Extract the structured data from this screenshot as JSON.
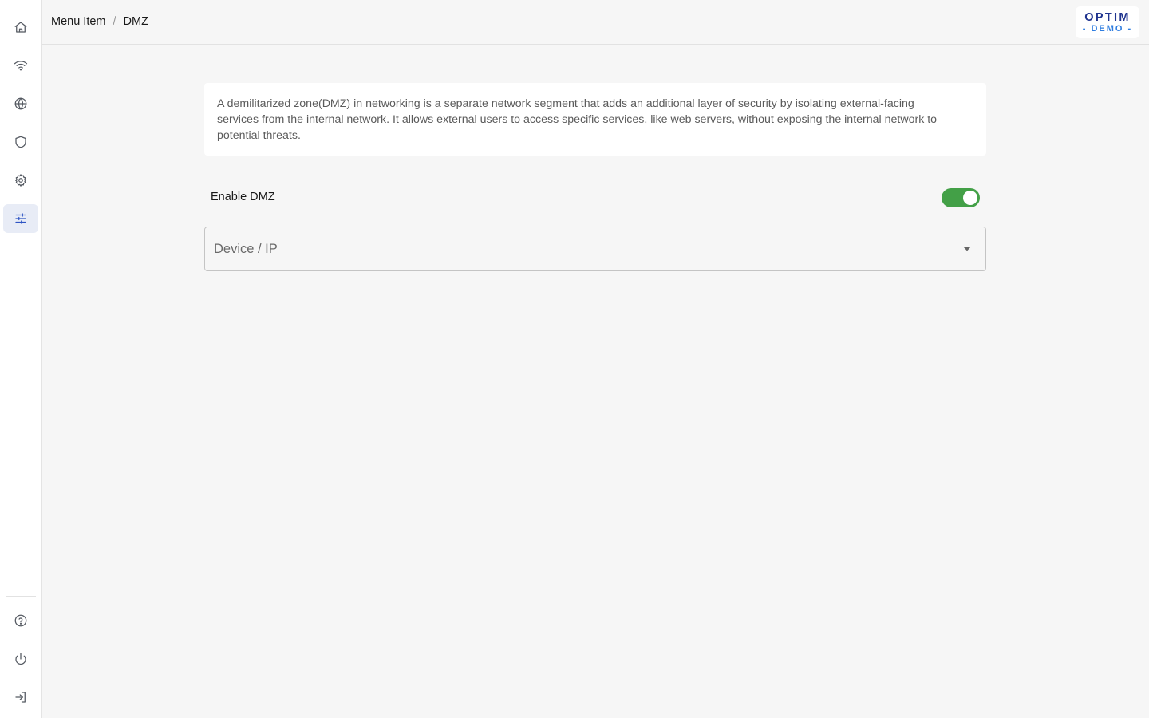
{
  "sidebar": {
    "items": [
      {
        "name": "home",
        "icon": "home-icon"
      },
      {
        "name": "wifi",
        "icon": "wifi-icon"
      },
      {
        "name": "internet",
        "icon": "globe-icon"
      },
      {
        "name": "security",
        "icon": "shield-icon"
      },
      {
        "name": "settings",
        "icon": "gear-icon"
      },
      {
        "name": "advanced",
        "icon": "sliders-icon",
        "active": true
      }
    ],
    "bottom_items": [
      {
        "name": "help",
        "icon": "help-circle-icon"
      },
      {
        "name": "power",
        "icon": "power-icon"
      },
      {
        "name": "logout",
        "icon": "logout-icon"
      }
    ]
  },
  "header": {
    "breadcrumb": {
      "parent": "Menu Item",
      "separator": "/",
      "current": "DMZ"
    },
    "logo": {
      "main": "OPTIM",
      "sub": "- DEMO -"
    }
  },
  "main": {
    "description": "A demilitarized zone(DMZ) in networking is a separate network segment that adds an additional layer of security by isolating external-facing services from the internal network. It allows external users to access specific services, like web servers, without exposing the internal network to potential threats.",
    "enable_dmz": {
      "label": "Enable DMZ",
      "enabled": true
    },
    "device_select": {
      "placeholder": "Device / IP",
      "value": ""
    }
  },
  "colors": {
    "accent": "#2f55c4",
    "toggle_on": "#43a047",
    "logo_primary": "#20348f",
    "logo_secondary": "#2f7de0"
  }
}
